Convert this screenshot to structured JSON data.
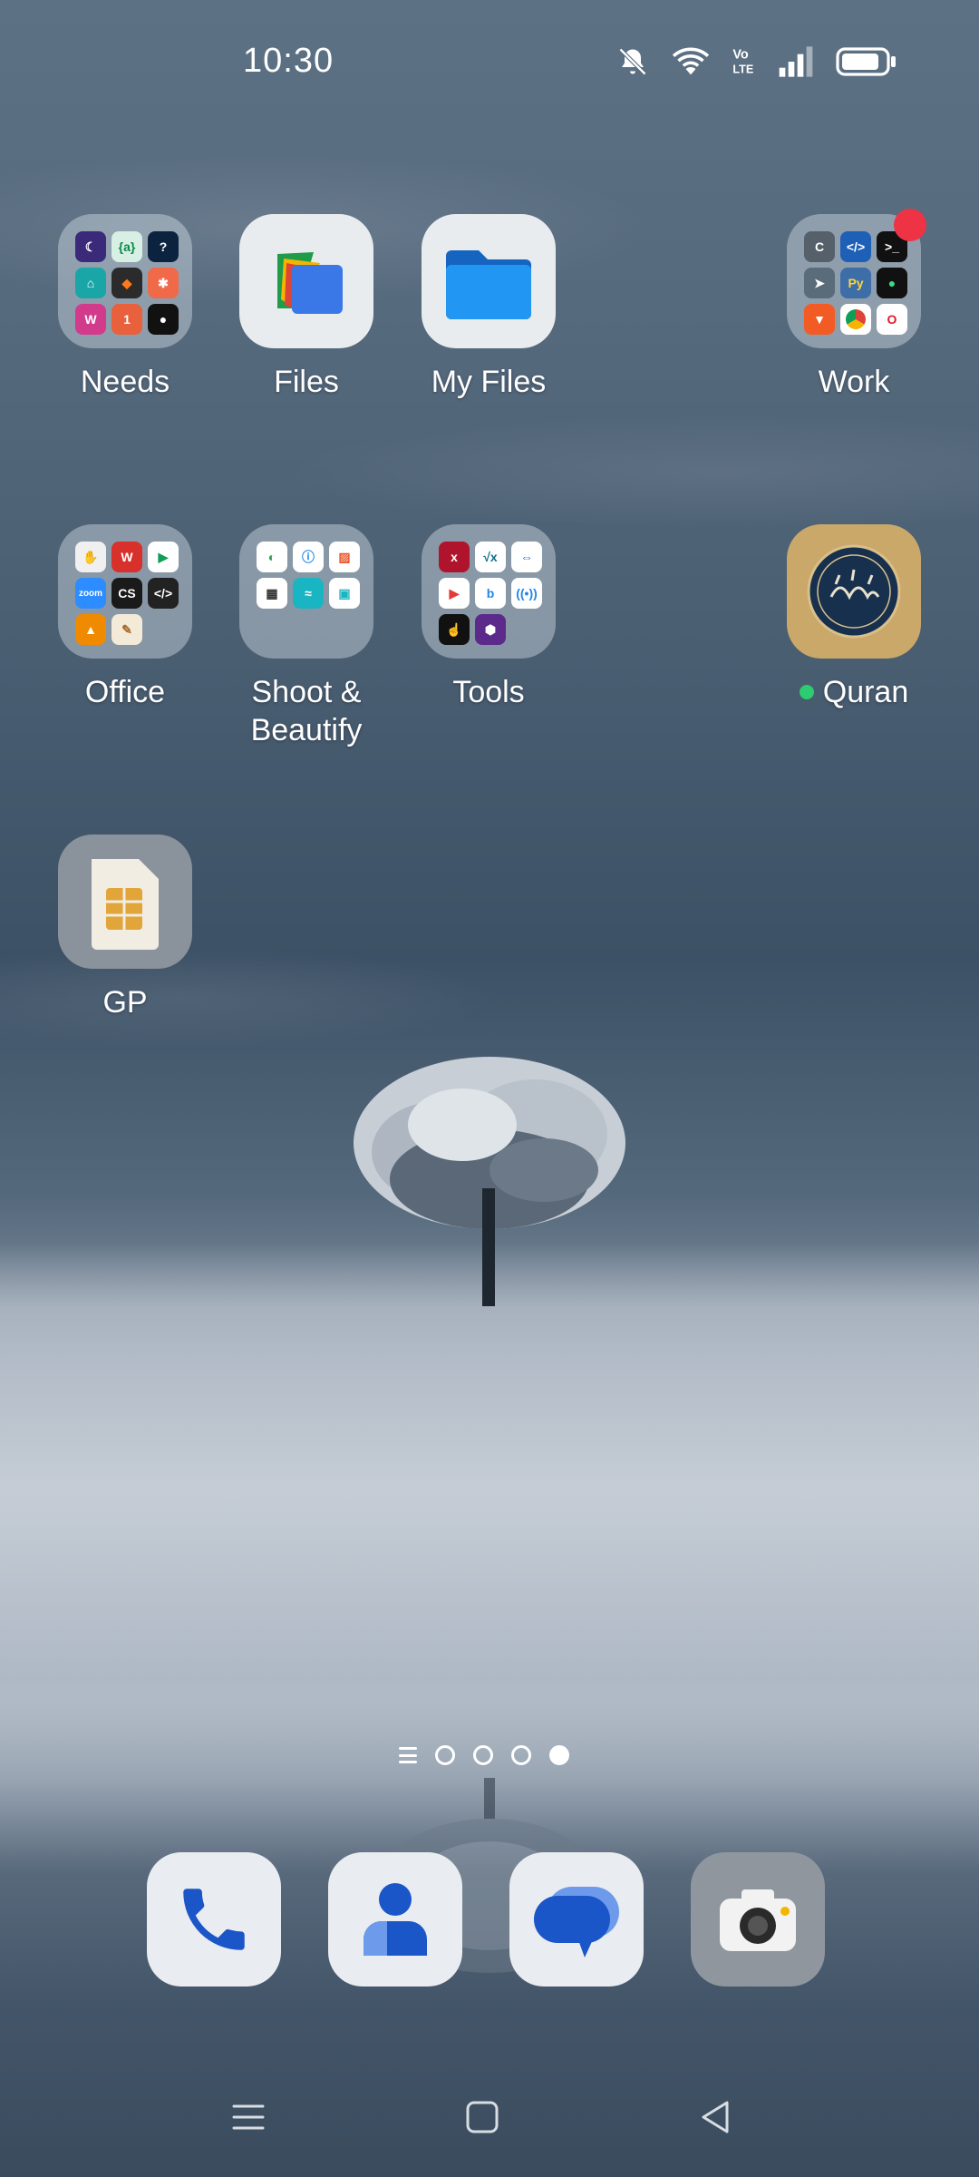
{
  "status_bar": {
    "time": "10:30",
    "icons": [
      "bell-muted-icon",
      "wifi-icon",
      "volte-icon",
      "signal-icon",
      "battery-icon"
    ]
  },
  "apps": {
    "needs": {
      "label": "Needs"
    },
    "files": {
      "label": "Files"
    },
    "my_files": {
      "label": "My Files"
    },
    "work": {
      "label": "Work",
      "has_badge": true
    },
    "office": {
      "label": "Office"
    },
    "shoot_beautify": {
      "label": "Shoot & Beautify"
    },
    "tools": {
      "label": "Tools"
    },
    "quran": {
      "label": "Quran",
      "new_indicator_color": "#2ecc71"
    },
    "gp": {
      "label": "GP"
    }
  },
  "page_indicator": {
    "pages": 4,
    "active_page": 4
  },
  "dock": [
    {
      "name": "phone",
      "icon": "phone-icon"
    },
    {
      "name": "contacts",
      "icon": "contacts-icon"
    },
    {
      "name": "messages",
      "icon": "messages-icon"
    },
    {
      "name": "camera",
      "icon": "camera-icon"
    }
  ],
  "nav_bar": [
    "menu-icon",
    "home-icon",
    "back-icon"
  ],
  "colors": {
    "badge": "#ee3344",
    "dock_blue": "#1a56c8",
    "folder_blue": "#1e88e5"
  }
}
